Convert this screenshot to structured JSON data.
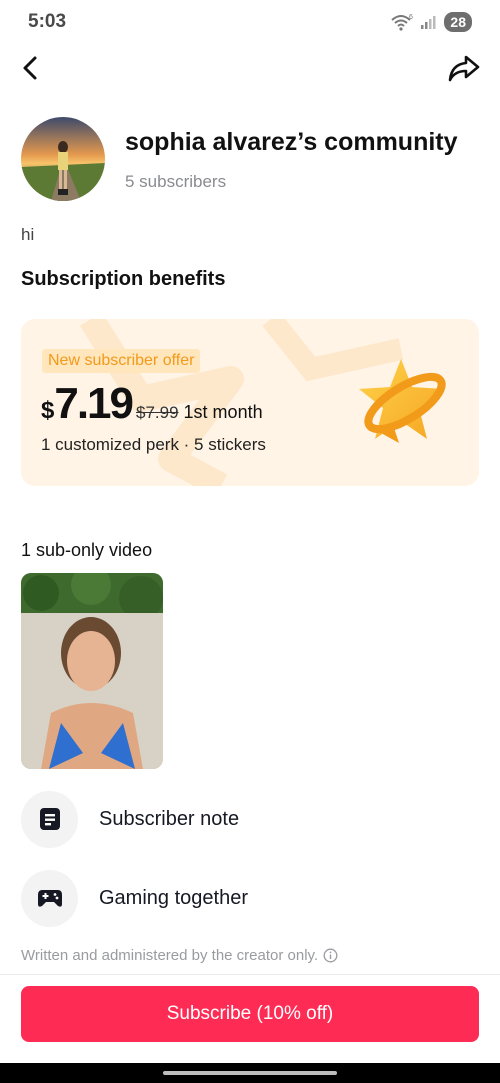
{
  "status_bar": {
    "time": "5:03",
    "battery": "28",
    "wifi_label": "6"
  },
  "header": {
    "back_icon": "chevron-left-icon",
    "share_icon": "share-arrow-icon"
  },
  "community": {
    "name": "sophia alvarez’s community",
    "subscribers": "5 subscribers",
    "bio": "hi"
  },
  "benefits": {
    "title": "Subscription benefits",
    "offer": {
      "badge": "New subscriber offer",
      "currency": "$",
      "price": "7.19",
      "original_price": "$7.99",
      "period": "1st month",
      "perks": "1 customized perk · 5 stickers",
      "accent_color": "#f5a623"
    }
  },
  "videos": {
    "label": "1 sub-only video"
  },
  "benefit_items": [
    {
      "label": "Subscriber note",
      "icon": "note-icon"
    },
    {
      "label": "Gaming together",
      "icon": "gamepad-icon"
    }
  ],
  "footer": {
    "note": "Written and administered by the creator only.",
    "subscribe_label": "Subscribe (10% off)",
    "button_color": "#fe2c55"
  }
}
